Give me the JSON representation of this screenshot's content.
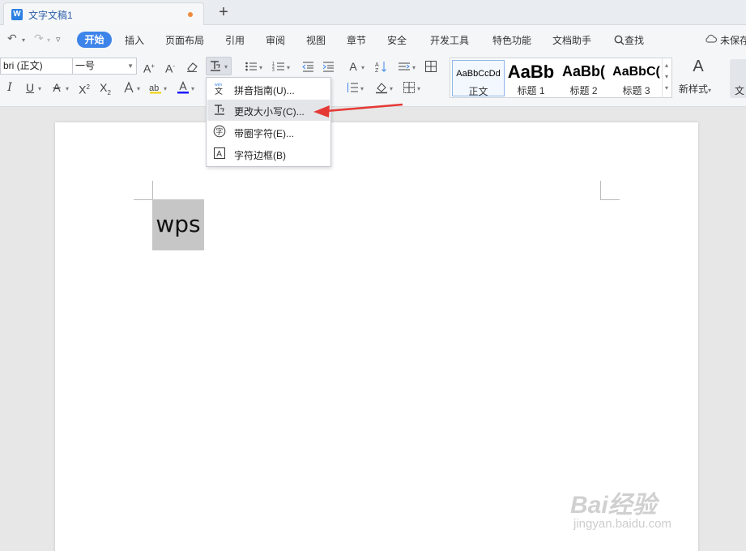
{
  "tab": {
    "title": "文字文稿1",
    "new_tab": "+"
  },
  "menu": {
    "items": [
      "开始",
      "插入",
      "页面布局",
      "引用",
      "审阅",
      "视图",
      "章节",
      "安全",
      "开发工具",
      "特色功能",
      "文档助手",
      "查找"
    ],
    "active": "开始",
    "unsaved_label": "未保存"
  },
  "font": {
    "name": "bri (正文)",
    "size": "一号"
  },
  "styles": [
    {
      "sample": "AaBbCcDd",
      "name": "正文"
    },
    {
      "sample": "AaBb",
      "name": "标题 1"
    },
    {
      "sample": "AaBb(",
      "name": "标题 2"
    },
    {
      "sample": "AaBbC(",
      "name": "标题 3"
    }
  ],
  "new_style_label": "新样式",
  "cut_button_label": "文",
  "dropdown": {
    "items": [
      {
        "label": "拼音指南(U)...",
        "icon": "pinyin-icon"
      },
      {
        "label": "更改大小写(C)...",
        "icon": "change-case-icon"
      },
      {
        "label": "带圈字符(E)...",
        "icon": "enclosed-character-icon"
      },
      {
        "label": "字符边框(B)",
        "icon": "character-border-icon"
      }
    ],
    "highlighted": "更改大小写(C)..."
  },
  "document": {
    "selected_text": "wps"
  },
  "colors": {
    "accent": "#3d84ea",
    "annotation_arrow": "#e53935",
    "tab_dot": "#f08a3b",
    "selection": "#c6c6c6"
  },
  "watermark": {
    "brand": "Bai经验",
    "site": "jingyan.baidu.com"
  }
}
